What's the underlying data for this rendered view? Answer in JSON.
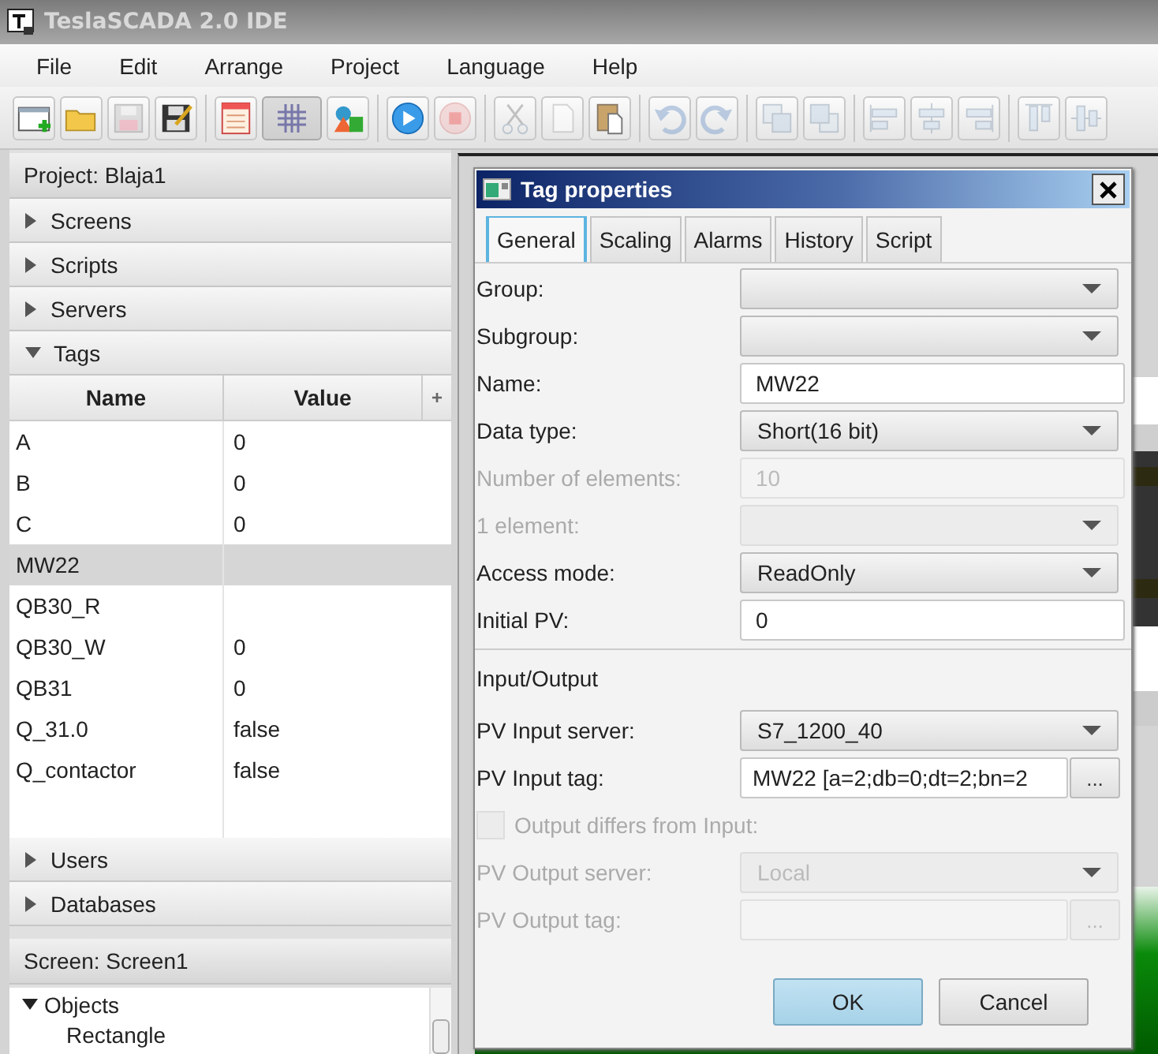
{
  "window": {
    "title": "TeslaSCADA 2.0 IDE"
  },
  "menu": [
    "File",
    "Edit",
    "Arrange",
    "Project",
    "Language",
    "Help"
  ],
  "toolbar": [
    {
      "kind": "new",
      "disabled": false,
      "pressed": false
    },
    {
      "kind": "open",
      "disabled": false,
      "pressed": false
    },
    {
      "kind": "save",
      "disabled": true,
      "pressed": false
    },
    {
      "kind": "save-as",
      "disabled": false,
      "pressed": false
    },
    {
      "kind": "sep"
    },
    {
      "kind": "properties",
      "disabled": false,
      "pressed": false
    },
    {
      "kind": "grid",
      "disabled": false,
      "pressed": true
    },
    {
      "kind": "shapes",
      "disabled": false,
      "pressed": false
    },
    {
      "kind": "sep"
    },
    {
      "kind": "run",
      "disabled": false,
      "pressed": false
    },
    {
      "kind": "stop",
      "disabled": true,
      "pressed": false
    },
    {
      "kind": "sep"
    },
    {
      "kind": "cut",
      "disabled": true,
      "pressed": false
    },
    {
      "kind": "copy",
      "disabled": true,
      "pressed": false
    },
    {
      "kind": "paste",
      "disabled": false,
      "pressed": false
    },
    {
      "kind": "sep"
    },
    {
      "kind": "undo",
      "disabled": true,
      "pressed": false
    },
    {
      "kind": "redo",
      "disabled": true,
      "pressed": false
    },
    {
      "kind": "sep"
    },
    {
      "kind": "front",
      "disabled": true,
      "pressed": false
    },
    {
      "kind": "back",
      "disabled": true,
      "pressed": false
    },
    {
      "kind": "sep"
    },
    {
      "kind": "align-left",
      "disabled": true,
      "pressed": false
    },
    {
      "kind": "align-center",
      "disabled": true,
      "pressed": false
    },
    {
      "kind": "align-right",
      "disabled": true,
      "pressed": false
    },
    {
      "kind": "sep"
    },
    {
      "kind": "align-top",
      "disabled": true,
      "pressed": false
    },
    {
      "kind": "align-middle",
      "disabled": true,
      "pressed": false
    }
  ],
  "project": {
    "title": "Project: Blaja1",
    "sections_before": [
      {
        "label": "Screens",
        "expanded": false
      },
      {
        "label": "Scripts",
        "expanded": false
      },
      {
        "label": "Servers",
        "expanded": false
      },
      {
        "label": "Tags",
        "expanded": true
      }
    ],
    "tags_table": {
      "columns": [
        "Name",
        "Value"
      ],
      "add_column": "+",
      "rows": [
        {
          "name": "A",
          "value": "0",
          "selected": false
        },
        {
          "name": "B",
          "value": "0",
          "selected": false
        },
        {
          "name": "C",
          "value": "0",
          "selected": false
        },
        {
          "name": "MW22",
          "selected": true
        },
        {
          "name": "QB30_R",
          "selected": false
        },
        {
          "name": "QB30_W",
          "value": "0",
          "selected": false
        },
        {
          "name": "QB31",
          "value": "0",
          "selected": false
        },
        {
          "name": "Q_31.0",
          "value": "false",
          "selected": false
        },
        {
          "name": "Q_contactor",
          "value": "false",
          "selected": false
        }
      ]
    },
    "sections_after": [
      {
        "label": "Users",
        "expanded": false
      },
      {
        "label": "Databases",
        "expanded": false
      }
    ]
  },
  "screen": {
    "title": "Screen: Screen1",
    "tree": [
      {
        "label": "Objects",
        "expanded": true,
        "children": [
          {
            "label": "Rectangle"
          }
        ]
      }
    ]
  },
  "dialog": {
    "title": "Tag properties",
    "tabs": [
      {
        "label": "General",
        "selected": true
      },
      {
        "label": "Scaling",
        "selected": false
      },
      {
        "label": "Alarms",
        "selected": false
      },
      {
        "label": "History",
        "selected": false
      },
      {
        "label": "Script",
        "selected": false
      }
    ],
    "rows": [
      {
        "kind": "dropdown",
        "label": "Group:",
        "disabled": false
      },
      {
        "kind": "dropdown",
        "label": "Subgroup:",
        "disabled": false
      },
      {
        "kind": "text",
        "label": "Name:",
        "value": "MW22",
        "disabled": false
      },
      {
        "kind": "dropdown",
        "label": "Data type:",
        "value": "Short(16 bit)",
        "disabled": false
      },
      {
        "kind": "text",
        "label": "Number of elements:",
        "value": "10",
        "disabled": true
      },
      {
        "kind": "dropdown",
        "label": "1 element:",
        "disabled": true
      },
      {
        "kind": "dropdown",
        "label": "Access mode:",
        "value": "ReadOnly",
        "disabled": false
      },
      {
        "kind": "text",
        "label": "Initial PV:",
        "value": "0",
        "disabled": false
      },
      {
        "kind": "section",
        "label": "Input/Output"
      },
      {
        "kind": "dropdown",
        "label": "PV Input server:",
        "value": "S7_1200_40",
        "disabled": false
      },
      {
        "kind": "browse",
        "label": "PV Input tag:",
        "value": "MW22 [a=2;db=0;dt=2;bn=2",
        "button": "...",
        "disabled": false
      },
      {
        "kind": "checkbox",
        "label": "Output differs from Input:",
        "checked": false,
        "disabled": true
      },
      {
        "kind": "dropdown",
        "label": "PV Output server:",
        "value": "Local",
        "disabled": true
      },
      {
        "kind": "browse",
        "label": "PV Output tag:",
        "button": "...",
        "disabled": true
      }
    ],
    "buttons": [
      {
        "label": "OK",
        "default": true
      },
      {
        "label": "Cancel",
        "default": false
      }
    ]
  }
}
